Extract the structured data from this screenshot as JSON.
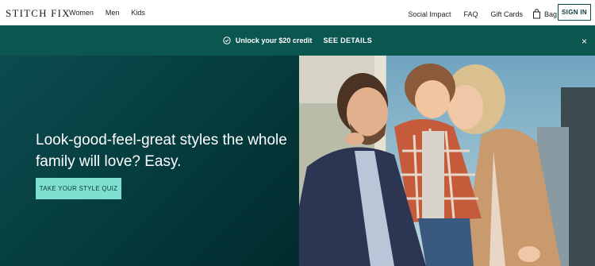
{
  "nav": {
    "logo": "STITCH FIX",
    "left_links": [
      "Women",
      "Men",
      "Kids"
    ],
    "right_links": [
      "Social Impact",
      "FAQ",
      "Gift Cards"
    ],
    "bag_label": "Bag",
    "sign_in": "SIGN IN"
  },
  "promo": {
    "text": "Unlock your $20 credit",
    "details": "SEE DETAILS",
    "close": "×"
  },
  "hero": {
    "headline": "Look-good-feel-great styles the whole family will love? Easy.",
    "cta": "TAKE YOUR STYLE QUIZ"
  },
  "colors": {
    "accent": "#7fe0cf",
    "promo_bg": "#0c5650",
    "hero_bg": "#053b3d"
  },
  "icons": [
    "check-circle-icon",
    "bag-icon",
    "close-icon"
  ]
}
